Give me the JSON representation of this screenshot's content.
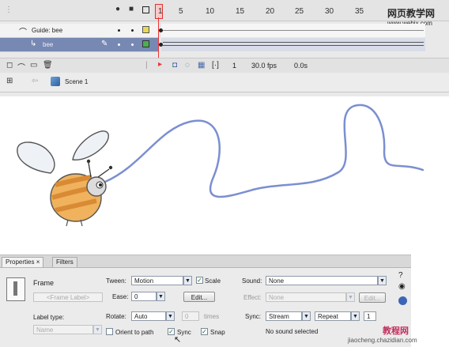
{
  "timeline": {
    "frame_numbers": [
      "1",
      "5",
      "10",
      "15",
      "20",
      "25",
      "30",
      "35"
    ],
    "layers": [
      {
        "name": "Guide: bee"
      },
      {
        "name": "bee"
      }
    ],
    "status": {
      "frame": "1",
      "fps": "30.0 fps",
      "time": "0.0s"
    },
    "scene_label": "Scene 1"
  },
  "watermark": {
    "cn": "网页教学网",
    "url": "www.webjx.com"
  },
  "properties": {
    "tabs": [
      "Properties",
      "Filters"
    ],
    "frame_label": "Frame",
    "frame_placeholder": "<Frame Label>",
    "label_type_label": "Label type:",
    "label_type_value": "Name",
    "tween_label": "Tween:",
    "tween_value": "Motion",
    "scale_label": "Scale",
    "ease_label": "Ease:",
    "ease_value": "0",
    "edit_button": "Edit...",
    "rotate_label": "Rotate:",
    "rotate_value": "Auto",
    "rotate_times_value": "0",
    "times_label": "times",
    "orient_label": "Orient to path",
    "sync_label": "Sync",
    "snap_label": "Snap",
    "sound_label": "Sound:",
    "sound_value": "None",
    "effect_label": "Effect:",
    "effect_value": "None",
    "effect_edit": "Edit...",
    "sync2_label": "Sync:",
    "sync2_value": "Stream",
    "repeat_value": "Repeat",
    "repeat_count": "1",
    "no_sound": "No sound selected"
  },
  "watermark2": {
    "cn": "教程网",
    "url": "jiaocheng.chazidian.com"
  },
  "colors": {
    "guide_path": "#7b8fd0",
    "playhead": "#e33333",
    "bee_body": "#f0b25c",
    "bee_stripe": "#d98a35"
  }
}
